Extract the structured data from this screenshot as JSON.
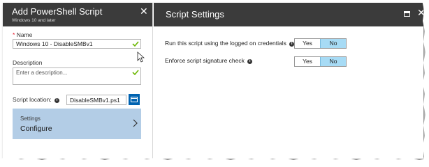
{
  "left_blade": {
    "title": "Add PowerShell Script",
    "subtitle": "Windows 10 and later",
    "close_glyph": "✕",
    "name_field": {
      "required_marker": "*",
      "label": "Name",
      "value": "Windows 10 - DisableSMBv1",
      "valid_icon": "checkmark-icon"
    },
    "description_field": {
      "label": "Description",
      "placeholder": "Enter a description...",
      "valid_icon": "checkmark-icon"
    },
    "script_location": {
      "label": "Script location:",
      "info_glyph": "i",
      "value": "DisableSMBv1.ps1",
      "browse_icon": "folder-icon"
    },
    "settings_item": {
      "small_label": "Settings",
      "large_label": "Configure",
      "chevron_icon": "chevron-right-icon"
    }
  },
  "right_blade": {
    "title": "Script Settings",
    "close_glyph": "✕",
    "maximize_icon": "maximize-icon",
    "rows": [
      {
        "label": "Run this script using the logged on credentials",
        "info_glyph": "i",
        "options": [
          "Yes",
          "No"
        ],
        "selected": "No"
      },
      {
        "label": "Enforce script signature check",
        "info_glyph": "i",
        "options": [
          "Yes",
          "No"
        ],
        "selected": "No"
      }
    ]
  },
  "colors": {
    "header_bg": "#3b3b3b",
    "settings_item_bg": "#b3cde6",
    "toggle_selected_bg": "#a7dbf5",
    "checkmark": "#6bb700",
    "browse_button": "#0063b1",
    "required_star": "#e81123"
  }
}
